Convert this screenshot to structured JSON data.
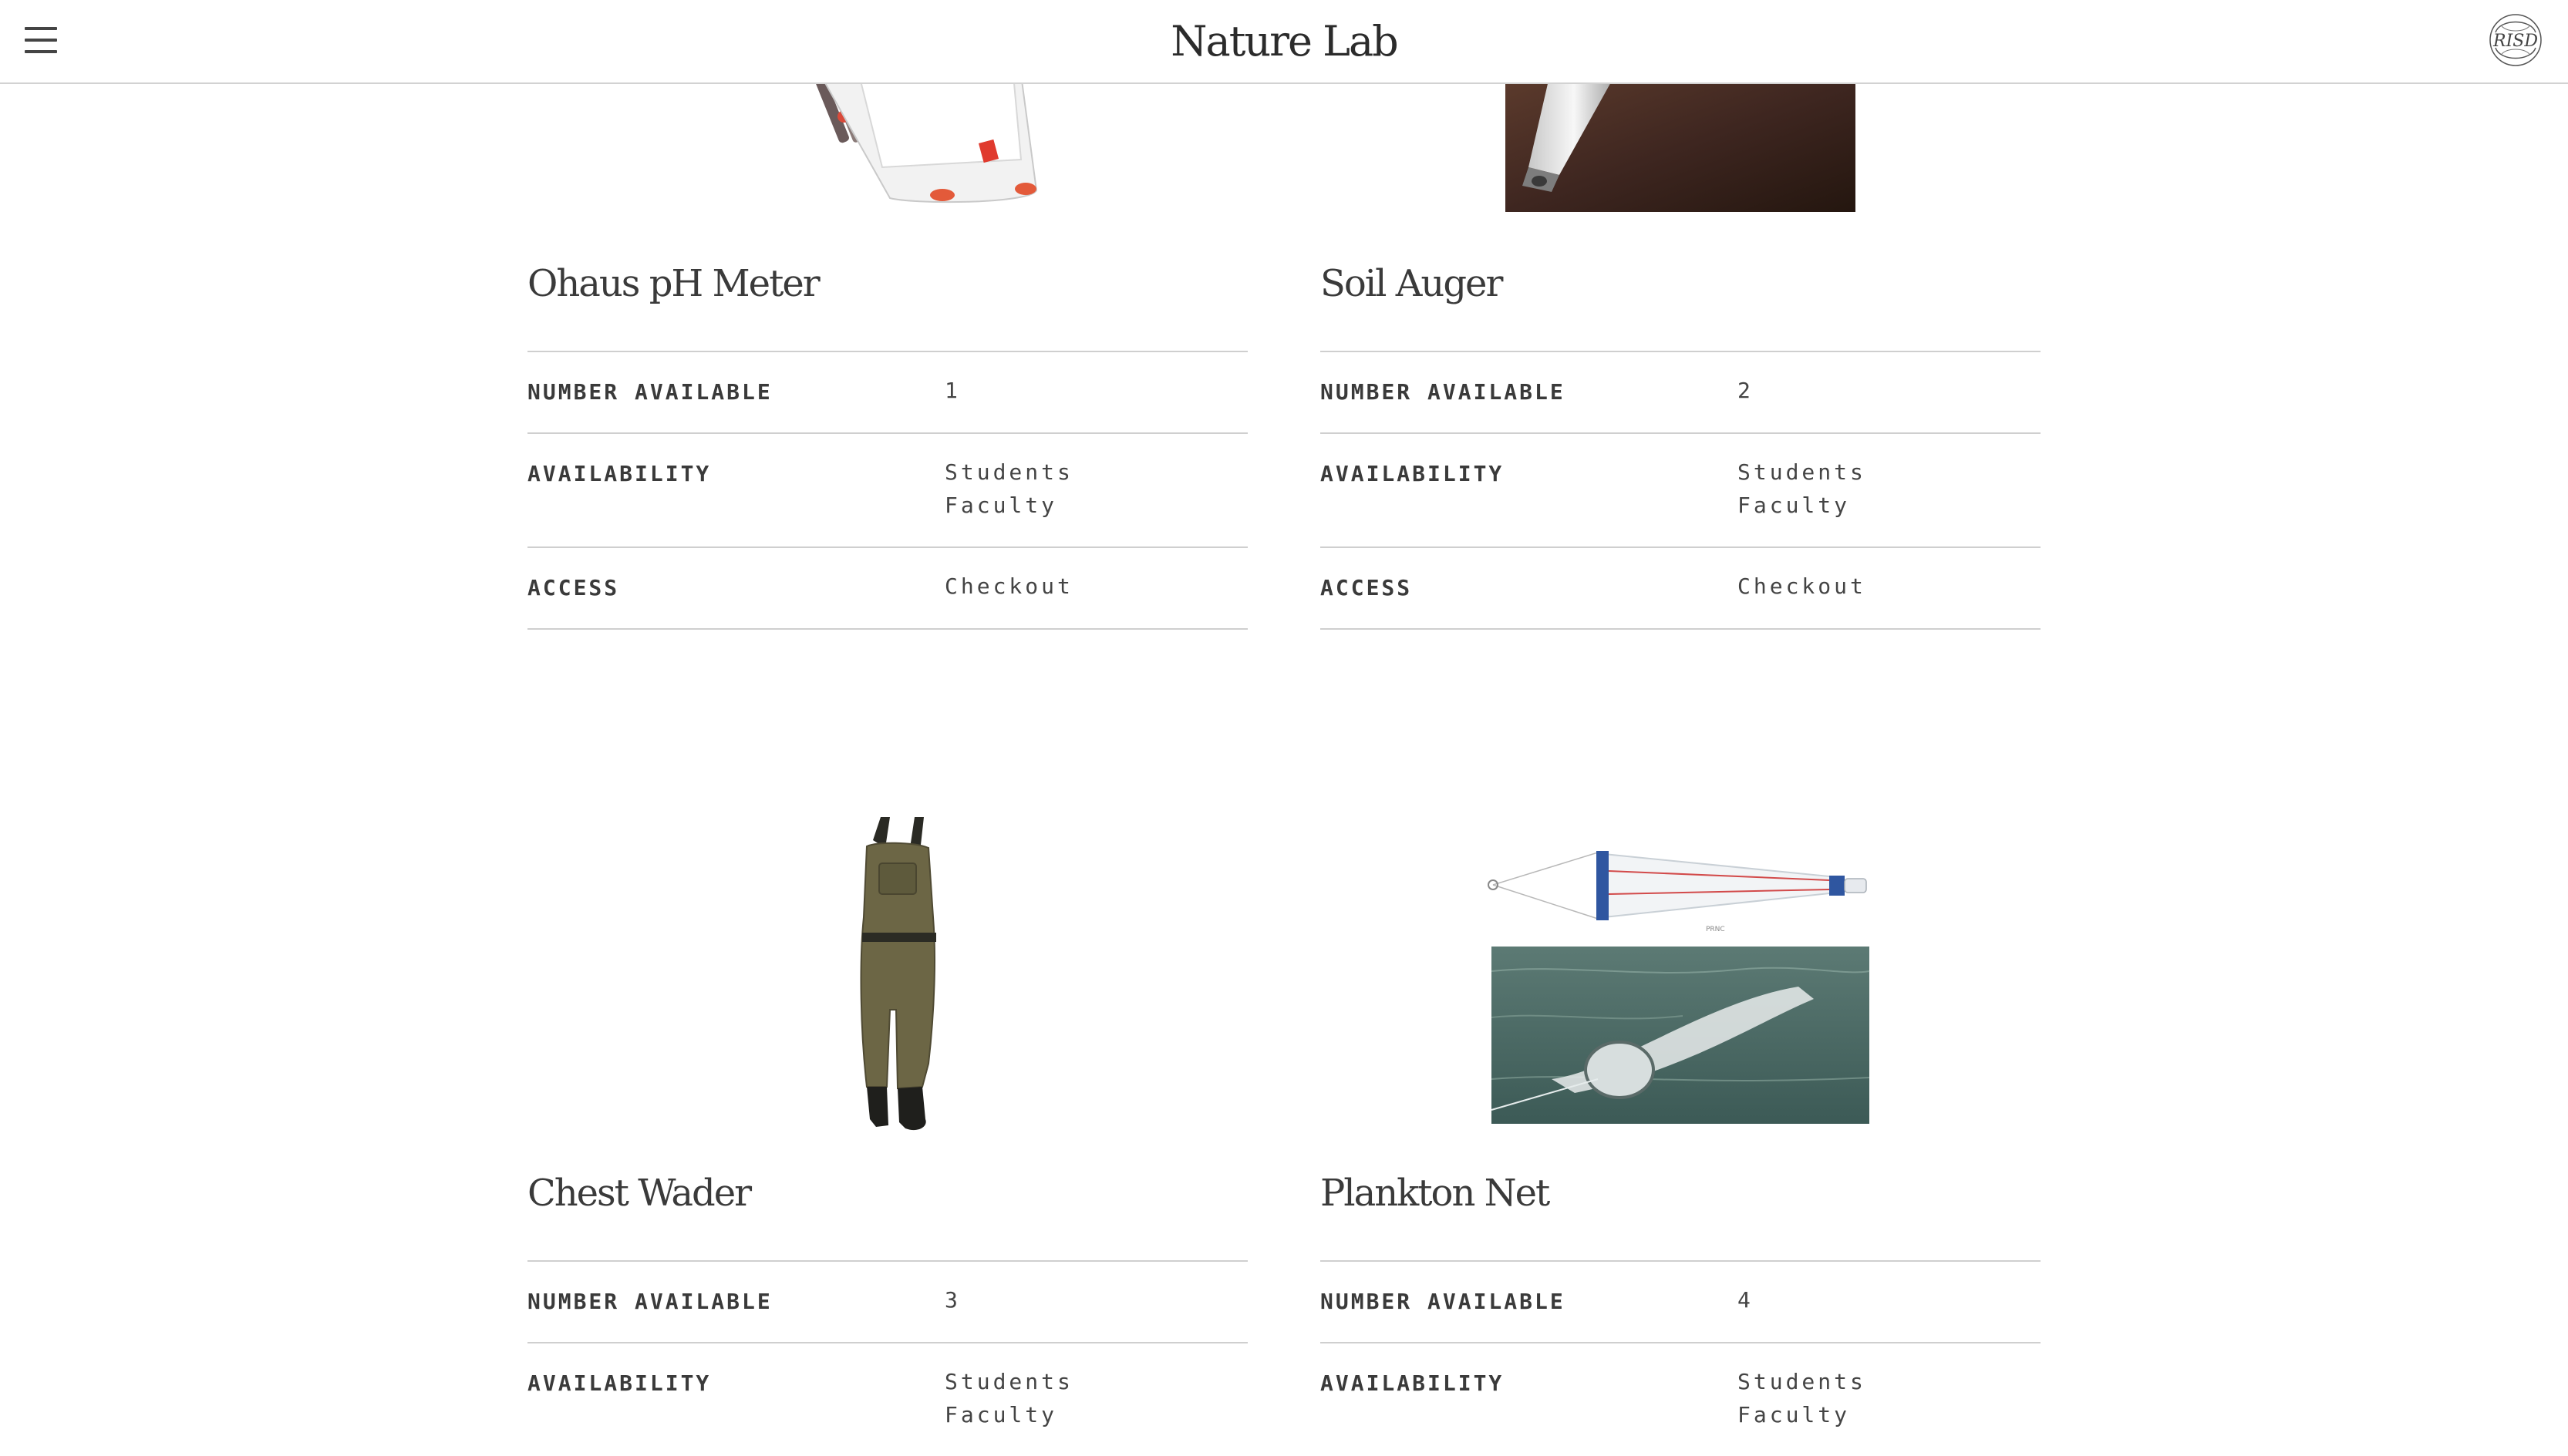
{
  "header": {
    "title": "Nature Lab",
    "logo_text": "RISD",
    "menu_icon": "hamburger-menu-icon"
  },
  "labels": {
    "number_available": "NUMBER AVAILABLE",
    "availability": "AVAILABILITY",
    "access": "ACCESS"
  },
  "items": [
    {
      "name": "Ohaus pH Meter",
      "number_available": "1",
      "availability": [
        "Students",
        "Faculty"
      ],
      "access": "Checkout"
    },
    {
      "name": "Soil Auger",
      "number_available": "2",
      "availability": [
        "Students",
        "Faculty"
      ],
      "access": "Checkout"
    },
    {
      "name": "Chest Wader",
      "number_available": "3",
      "availability": [
        "Students",
        "Faculty"
      ]
    },
    {
      "name": "Plankton Net",
      "number_available": "4",
      "availability": [
        "Students",
        "Faculty"
      ]
    }
  ]
}
